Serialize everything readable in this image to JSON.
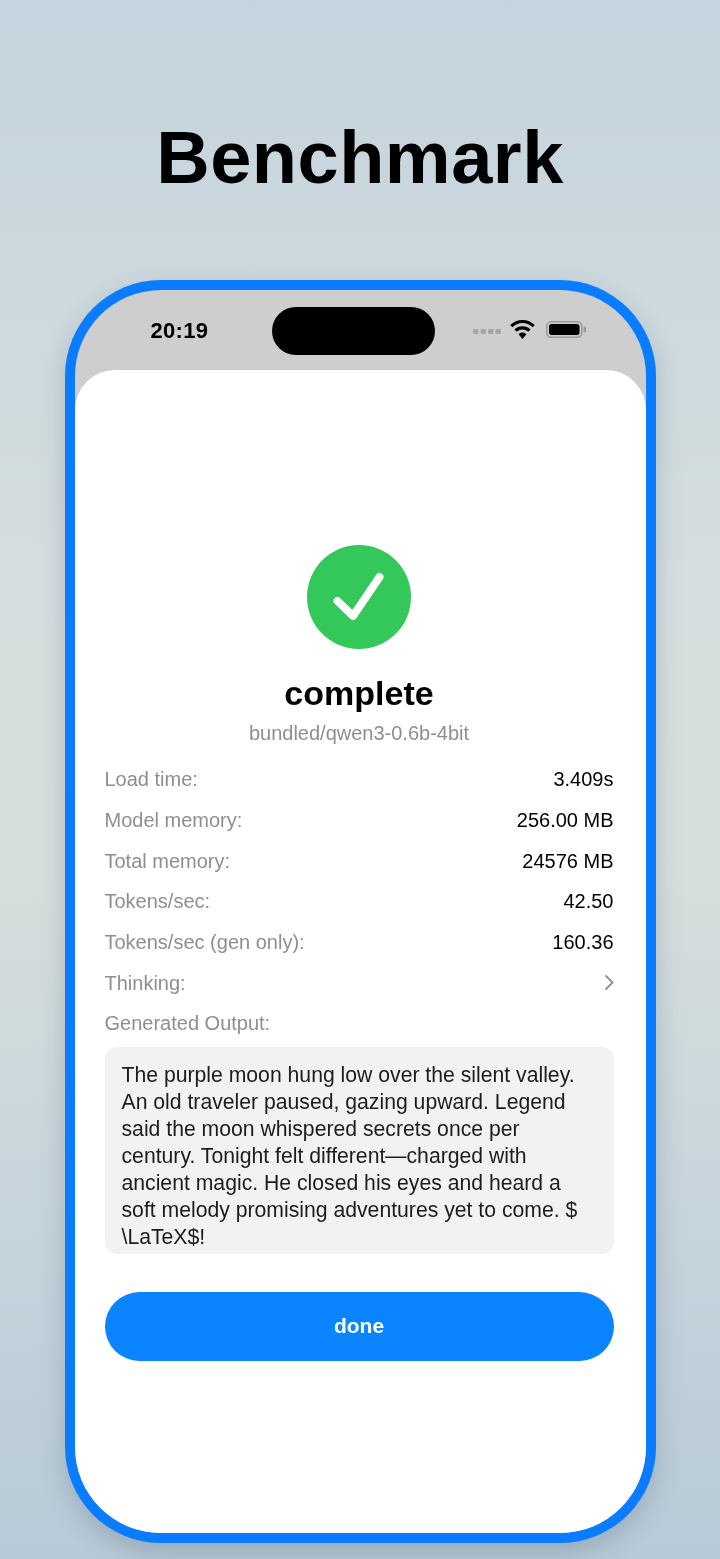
{
  "page_title": "Benchmark",
  "status_bar": {
    "time": "20:19"
  },
  "result": {
    "status": "complete",
    "model": "bundled/qwen3-0.6b-4bit"
  },
  "stats": [
    {
      "label": "Load time:",
      "value": "3.409s"
    },
    {
      "label": "Model memory:",
      "value": "256.00 MB"
    },
    {
      "label": "Total memory:",
      "value": "24576 MB"
    },
    {
      "label": "Tokens/sec:",
      "value": "42.50"
    },
    {
      "label": "Tokens/sec (gen only):",
      "value": "160.36"
    }
  ],
  "thinking": {
    "label": "Thinking:",
    "expanded": false
  },
  "output": {
    "label": "Generated Output:",
    "text": "The purple moon hung low over the silent valley. An old traveler paused, gazing upward. Legend said the moon whispered secrets once per century. Tonight felt different—charged with ancient magic. He closed his eyes and heard a soft melody promising adventures yet to come. $ \\LaTeX$!"
  },
  "done_button": "done"
}
